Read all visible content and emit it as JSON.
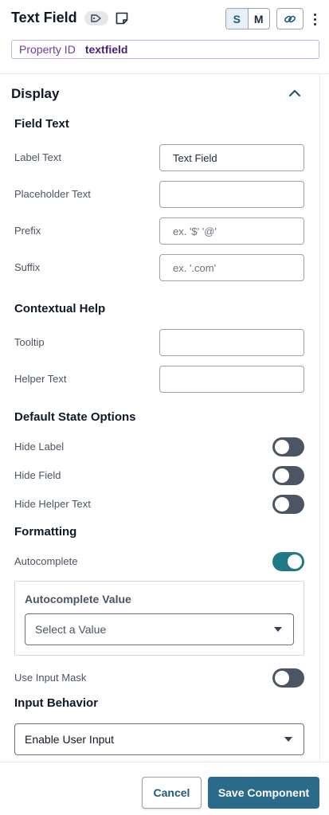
{
  "header": {
    "title": "Text Field",
    "size_options": [
      "S",
      "M"
    ],
    "selected_size": "S",
    "property_id_label": "Property ID",
    "property_id_value": "textfield"
  },
  "display": {
    "section_title": "Display",
    "field_text": {
      "title": "Field Text",
      "label_text_label": "Label Text",
      "label_text_value": "Text Field",
      "placeholder_text_label": "Placeholder Text",
      "placeholder_text_value": "",
      "prefix_label": "Prefix",
      "prefix_placeholder": "ex. '$' '@'",
      "suffix_label": "Suffix",
      "suffix_placeholder": "ex. '.com'"
    },
    "contextual_help": {
      "title": "Contextual Help",
      "tooltip_label": "Tooltip",
      "tooltip_value": "",
      "helper_text_label": "Helper Text",
      "helper_text_value": ""
    },
    "default_state": {
      "title": "Default State Options",
      "hide_label": "Hide Label",
      "hide_label_on": false,
      "hide_field": "Hide Field",
      "hide_field_on": false,
      "hide_helper_text": "Hide Helper Text",
      "hide_helper_text_on": false
    },
    "formatting": {
      "title": "Formatting",
      "autocomplete_label": "Autocomplete",
      "autocomplete_on": true,
      "autocomplete_value_title": "Autocomplete Value",
      "autocomplete_value_placeholder": "Select a Value",
      "use_input_mask_label": "Use Input Mask",
      "use_input_mask_on": false
    },
    "input_behavior": {
      "title": "Input Behavior",
      "selected": "Enable User Input"
    }
  },
  "footer": {
    "cancel_label": "Cancel",
    "save_label": "Save Component"
  },
  "colors": {
    "accent": "#2a6b8a",
    "toggle_on": "#1f7a85",
    "toggle_off": "#4b5563",
    "property_id": "#6b3fa0"
  },
  "icons": [
    "tag-icon",
    "note-icon",
    "link-icon",
    "more-vertical-icon",
    "chevron-up-icon",
    "caret-down-icon"
  ]
}
